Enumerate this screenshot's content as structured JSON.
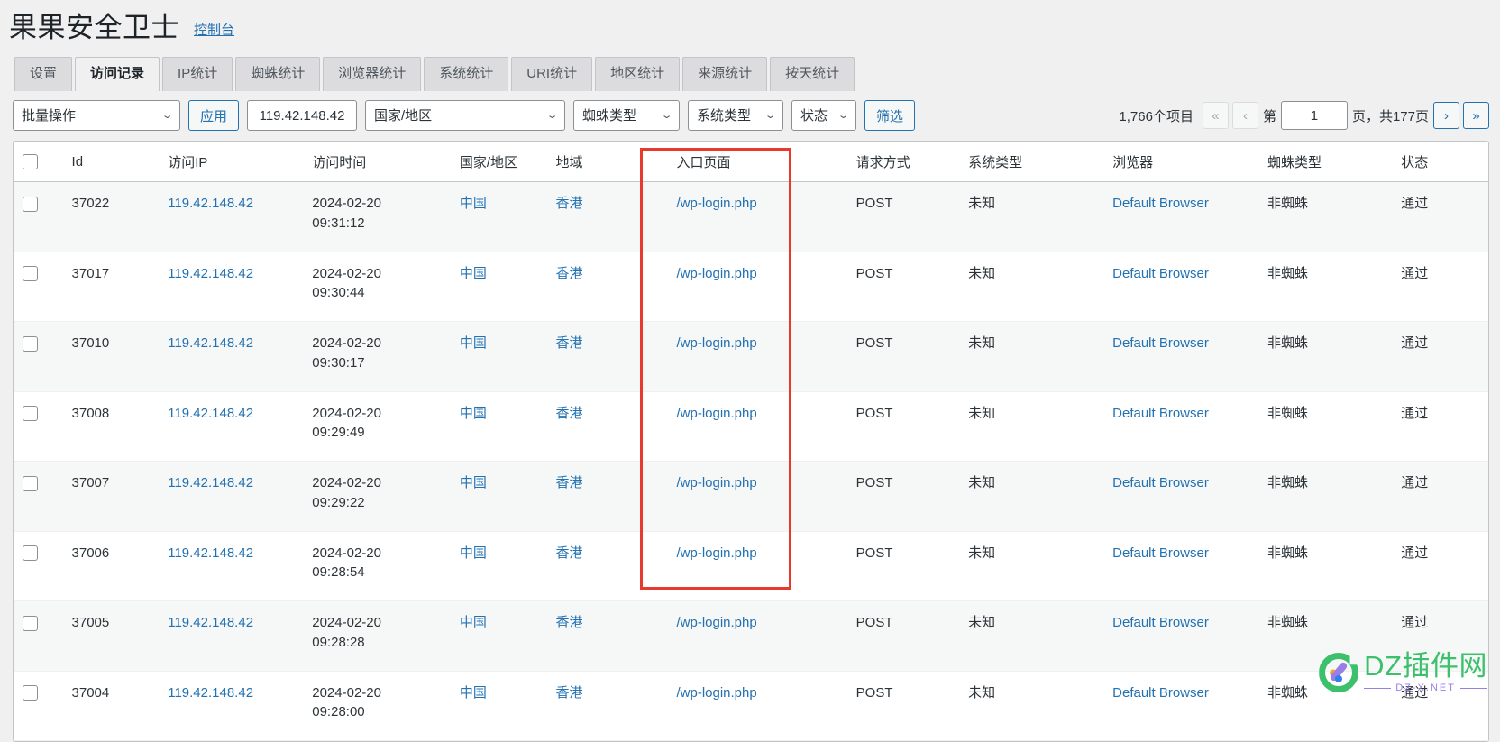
{
  "header": {
    "title": "果果安全卫士",
    "console_link": "控制台"
  },
  "tabs": [
    {
      "label": "设置",
      "active": false
    },
    {
      "label": "访问记录",
      "active": true
    },
    {
      "label": "IP统计",
      "active": false
    },
    {
      "label": "蜘蛛统计",
      "active": false
    },
    {
      "label": "浏览器统计",
      "active": false
    },
    {
      "label": "系统统计",
      "active": false
    },
    {
      "label": "URI统计",
      "active": false
    },
    {
      "label": "地区统计",
      "active": false
    },
    {
      "label": "来源统计",
      "active": false
    },
    {
      "label": "按天统计",
      "active": false
    }
  ],
  "toolbar": {
    "bulk_action": "批量操作",
    "apply_label": "应用",
    "ip_value": "119.42.148.42",
    "country_select": "国家/地区",
    "spider_select": "蜘蛛类型",
    "system_select": "系统类型",
    "status_select": "状态",
    "filter_label": "筛选",
    "chevron": "⌄"
  },
  "pagination": {
    "count_text": "1,766个项目",
    "first_label": "«",
    "prev_label": "‹",
    "page_prefix": "第",
    "page_value": "1",
    "page_suffix": "页，共177页",
    "next_label": "›",
    "last_label": "»"
  },
  "table": {
    "columns": [
      "Id",
      "访问IP",
      "访问时间",
      "国家/地区",
      "地域",
      "入口页面",
      "请求方式",
      "系统类型",
      "浏览器",
      "蜘蛛类型",
      "状态"
    ],
    "rows": [
      {
        "id": "37022",
        "ip": "119.42.148.42",
        "date": "2024-02-20",
        "time": "09:31:12",
        "country": "中国",
        "region": "香港",
        "entry": "/wp-login.php",
        "method": "POST",
        "os": "未知",
        "browser": "Default Browser",
        "spider": "非蜘蛛",
        "status": "通过"
      },
      {
        "id": "37017",
        "ip": "119.42.148.42",
        "date": "2024-02-20",
        "time": "09:30:44",
        "country": "中国",
        "region": "香港",
        "entry": "/wp-login.php",
        "method": "POST",
        "os": "未知",
        "browser": "Default Browser",
        "spider": "非蜘蛛",
        "status": "通过"
      },
      {
        "id": "37010",
        "ip": "119.42.148.42",
        "date": "2024-02-20",
        "time": "09:30:17",
        "country": "中国",
        "region": "香港",
        "entry": "/wp-login.php",
        "method": "POST",
        "os": "未知",
        "browser": "Default Browser",
        "spider": "非蜘蛛",
        "status": "通过"
      },
      {
        "id": "37008",
        "ip": "119.42.148.42",
        "date": "2024-02-20",
        "time": "09:29:49",
        "country": "中国",
        "region": "香港",
        "entry": "/wp-login.php",
        "method": "POST",
        "os": "未知",
        "browser": "Default Browser",
        "spider": "非蜘蛛",
        "status": "通过"
      },
      {
        "id": "37007",
        "ip": "119.42.148.42",
        "date": "2024-02-20",
        "time": "09:29:22",
        "country": "中国",
        "region": "香港",
        "entry": "/wp-login.php",
        "method": "POST",
        "os": "未知",
        "browser": "Default Browser",
        "spider": "非蜘蛛",
        "status": "通过"
      },
      {
        "id": "37006",
        "ip": "119.42.148.42",
        "date": "2024-02-20",
        "time": "09:28:54",
        "country": "中国",
        "region": "香港",
        "entry": "/wp-login.php",
        "method": "POST",
        "os": "未知",
        "browser": "Default Browser",
        "spider": "非蜘蛛",
        "status": "通过"
      },
      {
        "id": "37005",
        "ip": "119.42.148.42",
        "date": "2024-02-20",
        "time": "09:28:28",
        "country": "中国",
        "region": "香港",
        "entry": "/wp-login.php",
        "method": "POST",
        "os": "未知",
        "browser": "Default Browser",
        "spider": "非蜘蛛",
        "status": "通过"
      },
      {
        "id": "37004",
        "ip": "119.42.148.42",
        "date": "2024-02-20",
        "time": "09:28:00",
        "country": "中国",
        "region": "香港",
        "entry": "/wp-login.php",
        "method": "POST",
        "os": "未知",
        "browser": "Default Browser",
        "spider": "非蜘蛛",
        "status": "通过"
      }
    ]
  },
  "watermark": {
    "title": "DZ插件网",
    "subtitle": "DZ-X.NET"
  },
  "colors": {
    "accent": "#2271b1",
    "annotation": "#e8392d",
    "brand_green": "#3dc06c",
    "brand_purple": "#9a7ee8"
  }
}
